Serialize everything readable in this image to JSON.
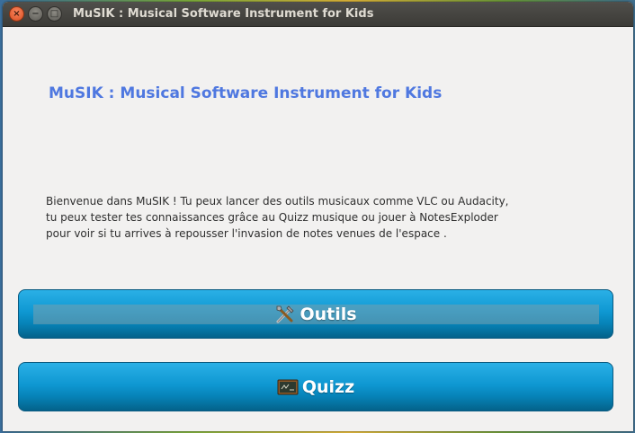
{
  "window": {
    "title": "MuSIK : Musical Software Instrument for Kids",
    "controls": {
      "close_glyph": "×",
      "minimize_glyph": "−",
      "maximize_glyph": "□"
    }
  },
  "main": {
    "heading": "MuSIK : Musical Software Instrument for Kids",
    "intro_lines": [
      "Bienvenue dans MuSIK ! Tu peux lancer des outils musicaux comme VLC ou Audacity,",
      "tu peux tester tes connaissances grâce au Quizz musique ou jouer à NotesExploder",
      "pour voir si tu arrives à repousser l'invasion de notes venues de l'espace ."
    ]
  },
  "buttons": {
    "outils": {
      "label": "Outils",
      "icon": "tools-icon"
    },
    "quizz": {
      "label": "Quizz",
      "icon": "chalkboard-icon"
    }
  },
  "colors": {
    "heading": "#4f78e0",
    "button_top": "#2ab0e6",
    "button_bottom": "#04628a",
    "titlebar": "#3c3b37"
  }
}
